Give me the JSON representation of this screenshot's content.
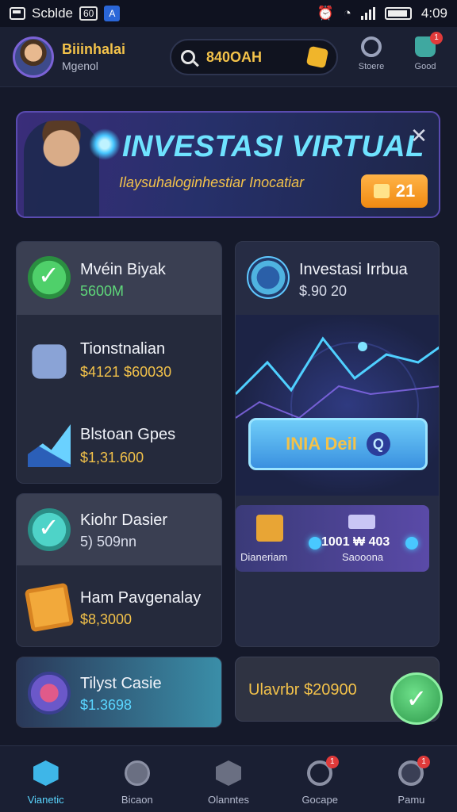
{
  "status_bar": {
    "left_text": "Scblde",
    "chip": "60",
    "badge": "A",
    "time": "4:09"
  },
  "header": {
    "user_name": "Biiinhalai",
    "user_sub": "Mgenol",
    "search_value": "840OAH",
    "icon_one_label": "Stoere",
    "icon_two_label": "Good",
    "icon_two_badge": "1"
  },
  "banner": {
    "title": "INVESTASI VIRTUAL",
    "subtitle": "Ilaysuhaloginhestiar Inocatiar",
    "badge_value": "21",
    "close_glyph": "✕"
  },
  "left_card_top": {
    "rows": [
      {
        "title": "Mvéin Biyak",
        "value": "5600M",
        "value_color": "#5fd87a"
      },
      {
        "title": "Tionstnalian",
        "value": "$4121 $60030",
        "value_color": "#f3c24a"
      },
      {
        "title": "Blstoan Gpes",
        "value": "$1,31.600",
        "value_color": "#f3c24a"
      }
    ]
  },
  "right_card": {
    "title": "Investasi Irrbua",
    "value": "$.90 20",
    "cta_label": "INIA Deil",
    "cta_q": "Q",
    "mini_left_label": "Dianeriam",
    "mini_value": "1001 ₩ 403",
    "mini_right_label": "Saooona"
  },
  "left_card_mid": {
    "rows": [
      {
        "title": "Kiohr Dasier",
        "value": "5) 509nn",
        "value_color": "#d8dcea"
      },
      {
        "title": "Ham Pavgenalay",
        "value": "$8,3000",
        "value_color": "#f3c24a"
      }
    ]
  },
  "left_card_bottom": {
    "title": "Tilyst Casie",
    "value": "$1.3698",
    "value_color": "#5ad6ff"
  },
  "right_card_bottom": {
    "text": "Ulavrbr $20900",
    "fab_glyph": "✓"
  },
  "bottom_nav": {
    "items": [
      {
        "label": "Vianetic",
        "active": true
      },
      {
        "label": "Bicaon",
        "active": false
      },
      {
        "label": "Olanntes",
        "active": false
      },
      {
        "label": "Gocape",
        "active": false,
        "badge": "1"
      },
      {
        "label": "Pamu",
        "active": false,
        "badge": "1"
      }
    ]
  },
  "colors": {
    "accent_gold": "#f3c24a",
    "accent_cyan": "#5ad6ff",
    "background": "#15192a"
  }
}
